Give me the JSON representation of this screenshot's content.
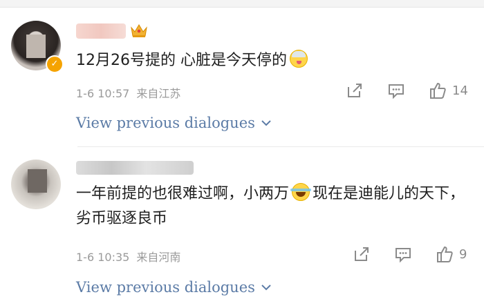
{
  "comments": [
    {
      "avatar_icon": "user-avatar",
      "badge": "✓",
      "text_before": "12月26号提的 心脏是今天停的",
      "emoji": "sick-face-emoji",
      "text_after": "",
      "time": "1-6 10:57",
      "location": "来自江苏",
      "like_count": "14",
      "view_previous": "View previous dialogues"
    },
    {
      "avatar_icon": "user-avatar",
      "text_before": "一年前提的也很难过啊，小两万",
      "emoji": "tears-of-joy-emoji",
      "text_after": "现在是迪能儿的天下，劣币驱逐良币",
      "time": "1-6 10:35",
      "location": "来自河南",
      "like_count": "9",
      "view_previous": "View previous dialogues"
    }
  ],
  "colors": {
    "link": "#5b7ba6",
    "meta": "#9a9a9a",
    "badge": "#f5a300"
  }
}
